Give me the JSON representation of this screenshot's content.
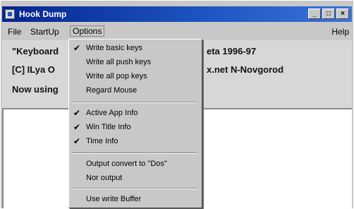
{
  "window": {
    "title": "Hook Dump",
    "minimize_glyph": "_",
    "maximize_glyph": "□",
    "close_glyph": "×"
  },
  "menubar": {
    "items": [
      "File",
      "StartUp",
      "Options"
    ],
    "help": "Help"
  },
  "content": {
    "line1_left": "\"Keyboard",
    "line1_right": "eta  1996-97",
    "line2_left": "[C] ILya O",
    "line2_right": "x.net N-Novgorod",
    "line3_left": "Now using"
  },
  "options_menu": {
    "items": [
      {
        "label": "Write basic keys",
        "checked": true
      },
      {
        "label": "Write all push keys",
        "checked": false
      },
      {
        "label": "Write all pop keys",
        "checked": false
      },
      {
        "label": "Regard Mouse",
        "checked": false
      },
      {
        "label": "Active App Info",
        "checked": true
      },
      {
        "label": "Win Title Info",
        "checked": true
      },
      {
        "label": "Time Info",
        "checked": true
      },
      {
        "label": "Output convert to \"Dos\"",
        "checked": false
      },
      {
        "label": "Nor output",
        "checked": false
      },
      {
        "label": "Use write Buffer",
        "checked": false
      }
    ],
    "check_glyph": "✔"
  }
}
